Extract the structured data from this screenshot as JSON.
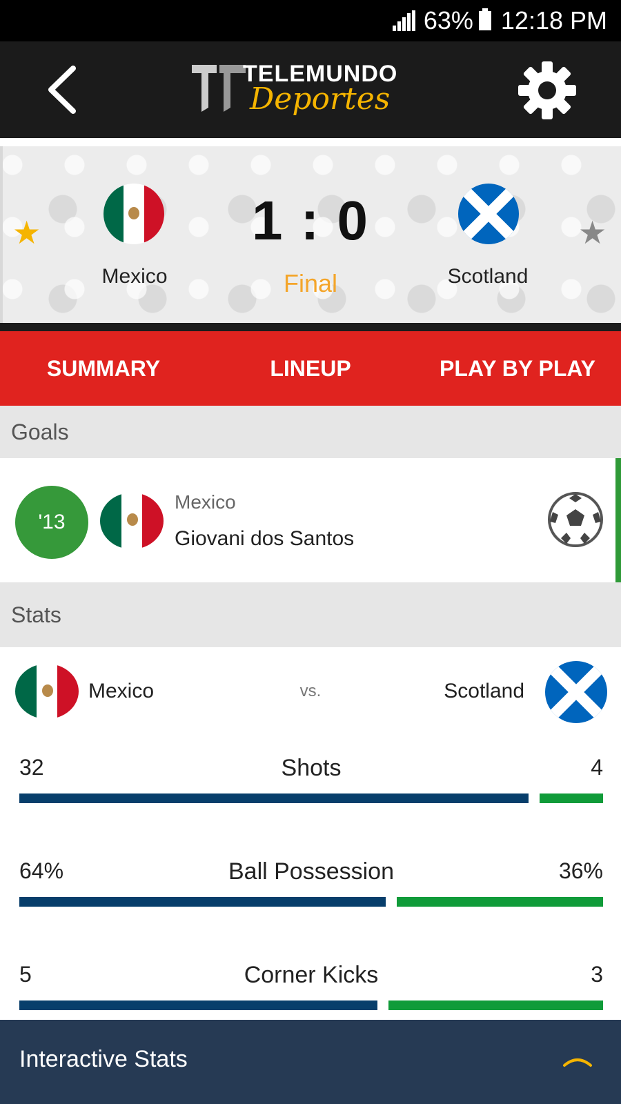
{
  "status_bar": {
    "battery": "63%",
    "time": "12:18 PM"
  },
  "header": {
    "logo_line1": "TELEMUNDO",
    "logo_line2": "Deportes"
  },
  "match": {
    "home_team": "Mexico",
    "away_team": "Scotland",
    "score": "1 : 0",
    "status": "Final",
    "home_favorite": true,
    "away_favorite": false
  },
  "tabs": [
    {
      "label": "SUMMARY"
    },
    {
      "label": "LINEUP"
    },
    {
      "label": "PLAY BY PLAY"
    }
  ],
  "goals": {
    "header": "Goals",
    "items": [
      {
        "minute": "'13",
        "team": "Mexico",
        "player": "Giovani dos Santos"
      }
    ]
  },
  "stats": {
    "header": "Stats",
    "home_team": "Mexico",
    "vs": "vs.",
    "away_team": "Scotland",
    "rows": [
      {
        "label": "Shots",
        "home": "32",
        "away": "4",
        "home_share": 0.889
      },
      {
        "label": "Ball Possession",
        "home": "64%",
        "away": "36%",
        "home_share": 0.64
      },
      {
        "label": "Corner Kicks",
        "home": "5",
        "away": "3",
        "home_share": 0.625
      }
    ]
  },
  "bottom_bar": {
    "title": "Interactive Stats"
  },
  "colors": {
    "tab_red": "#e0231f",
    "final_orange": "#f4a52a",
    "goal_green": "#36993a",
    "home_bar": "#073e6b",
    "away_bar": "#109b39",
    "bottom_navy": "#263a54",
    "chevron_gold": "#f5b400"
  }
}
